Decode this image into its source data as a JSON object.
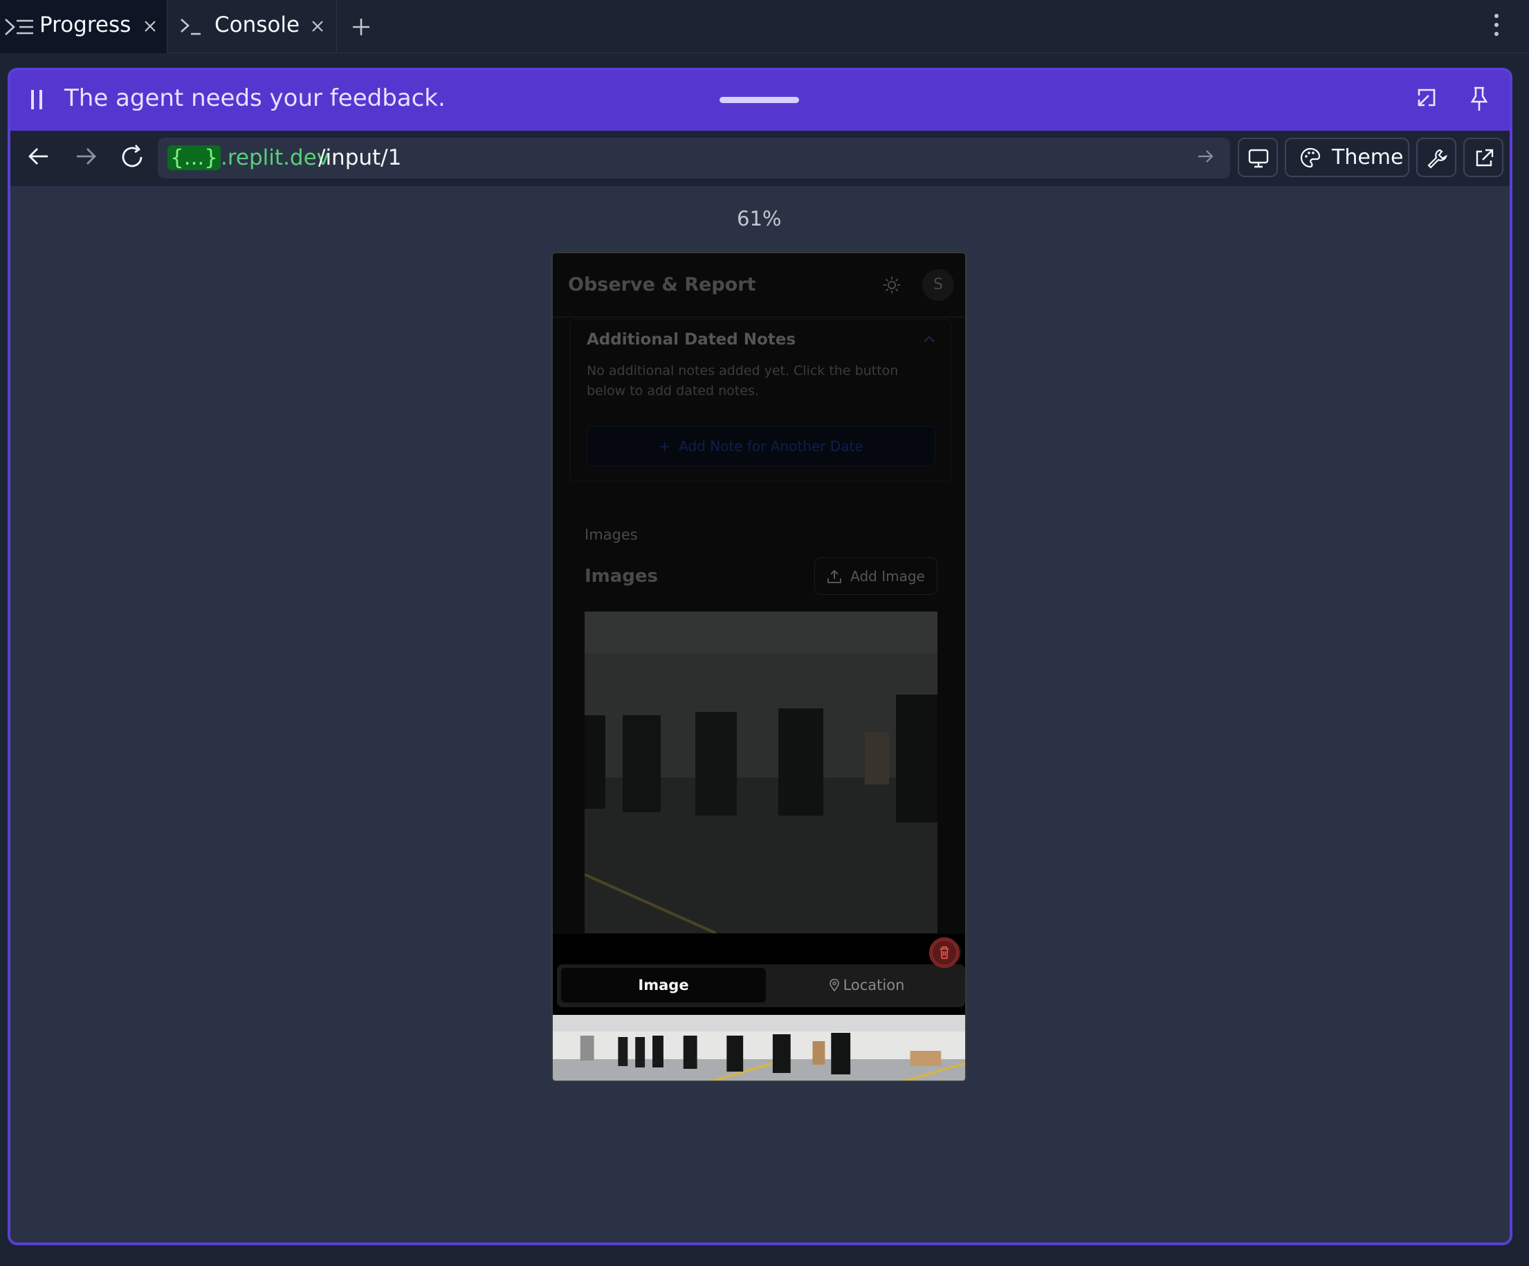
{
  "tabs": [
    {
      "label": "Progress",
      "icon": "progress-icon",
      "active": true
    },
    {
      "label": "Console",
      "icon": "terminal-icon",
      "active": false
    }
  ],
  "banner": {
    "message": "The agent needs your feedback."
  },
  "browser": {
    "host_braces": "{...}",
    "host_suffix": ".replit.dev",
    "path": "/input/1",
    "theme_label": "Theme",
    "zoom": "61%"
  },
  "app": {
    "title": "Observe & Report",
    "avatar_initial": "S",
    "notes_title": "Additional Dated Notes",
    "notes_empty": "No additional notes added yet. Click the button below to add dated notes.",
    "add_note_label": "Add Note for Another Date",
    "images_label": "Images",
    "images_heading": "Images",
    "add_image_label": "Add Image"
  },
  "drawer": {
    "tab_image": "Image",
    "tab_location": "Location"
  },
  "colors": {
    "accent": "#5537cf",
    "frame_border": "#5b3fd6",
    "url_green": "#58d07a",
    "panel_bg": "#2b3245"
  }
}
